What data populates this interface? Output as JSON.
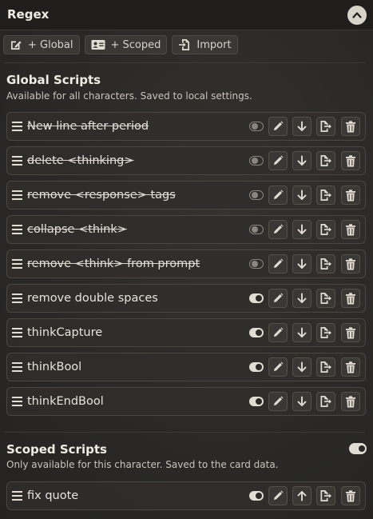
{
  "header": {
    "title": "Regex"
  },
  "toolbar": {
    "global_label": "+ Global",
    "scoped_label": "+ Scoped",
    "import_label": "Import"
  },
  "global": {
    "title": "Global Scripts",
    "subtitle": "Available for all characters. Saved to local settings.",
    "scripts": [
      {
        "name": "New line after period",
        "enabled": false
      },
      {
        "name": "delete <thinking>",
        "enabled": false
      },
      {
        "name": "remove <response> tags",
        "enabled": false
      },
      {
        "name": "collapse <think>",
        "enabled": false
      },
      {
        "name": "remove <think> from prompt",
        "enabled": false
      },
      {
        "name": "remove double spaces",
        "enabled": true
      },
      {
        "name": "thinkCapture",
        "enabled": true
      },
      {
        "name": "thinkBool",
        "enabled": true
      },
      {
        "name": "thinkEndBool",
        "enabled": true
      }
    ]
  },
  "scoped": {
    "title": "Scoped Scripts",
    "subtitle": "Only available for this character. Saved to the card data.",
    "enabled": true,
    "scripts": [
      {
        "name": "fix quote",
        "enabled": true
      }
    ]
  },
  "icons": {
    "collapse": "chevron-up-icon",
    "global": "edit-square-icon",
    "scoped": "id-card-icon",
    "import": "file-import-icon",
    "handle": "bars-icon",
    "edit": "pencil-icon",
    "move_down": "arrow-down-icon",
    "move_up": "arrow-up-icon",
    "export": "file-export-icon",
    "delete": "trash-icon"
  },
  "colors": {
    "panel_bg": "#2b2a28",
    "row_border": "#4a4742",
    "text": "#e4e0d8",
    "toggle_on": "#e2ddd3",
    "toggle_off": "#8b867d"
  }
}
